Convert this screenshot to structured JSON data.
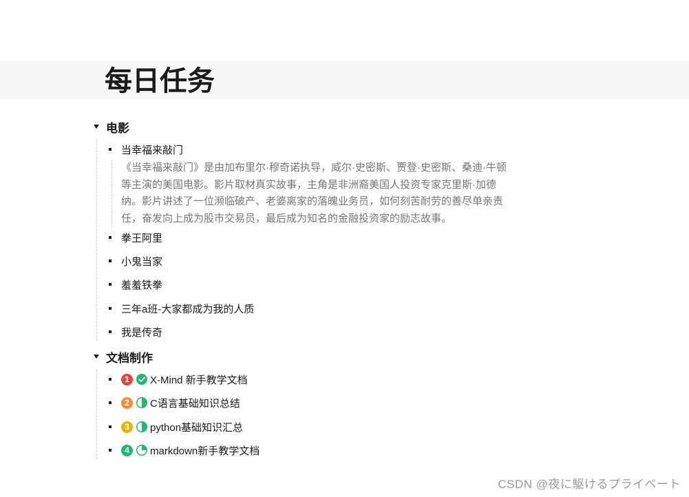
{
  "page": {
    "title": "每日任务"
  },
  "sections": [
    {
      "label": "电影",
      "items": [
        "当幸福来敲门",
        "拳王阿里",
        "小鬼当家",
        "羞羞铁拳",
        "三年a班-大家都成为我的人质",
        "我是传奇"
      ],
      "note_lines": [
        "《当幸福来敲门》是由加布里尔·穆奇诺执导，威尔·史密斯、贾登·史密斯、桑迪·牛顿",
        "等主演的美国电影。影片取材真实故事，主角是非洲裔美国人投资专家克里斯·加德",
        "纳。影片讲述了一位濒临破产、老婆离家的落魄业务员，如何刻苦耐劳的善尽单亲责",
        "任，奋发向上成为股市交易员，最后成为知名的金融投资家的励志故事。"
      ]
    },
    {
      "label": "文档制作",
      "items": [
        {
          "priority": "1",
          "priority_color": "#e8453c",
          "progress": 1.0,
          "label": "X-Mind 新手教学文档"
        },
        {
          "priority": "2",
          "priority_color": "#f08c3a",
          "progress": 0.5,
          "label": "C语言基础知识总结"
        },
        {
          "priority": "3",
          "priority_color": "#e8b400",
          "progress": 0.5,
          "label": "python基础知识汇总"
        },
        {
          "priority": "4",
          "priority_color": "#22b573",
          "progress": 0.25,
          "label": "markdown新手教学文档"
        }
      ]
    }
  ],
  "colors": {
    "progress": "#22b573"
  },
  "icons": {
    "collapse": "caret-down-icon",
    "bullet": "square-bullet-icon",
    "done": "check-circle-icon",
    "half": "half-circle-icon",
    "quarter": "pie-quarter-icon"
  },
  "watermark": "CSDN @夜に駆けるプライベート"
}
